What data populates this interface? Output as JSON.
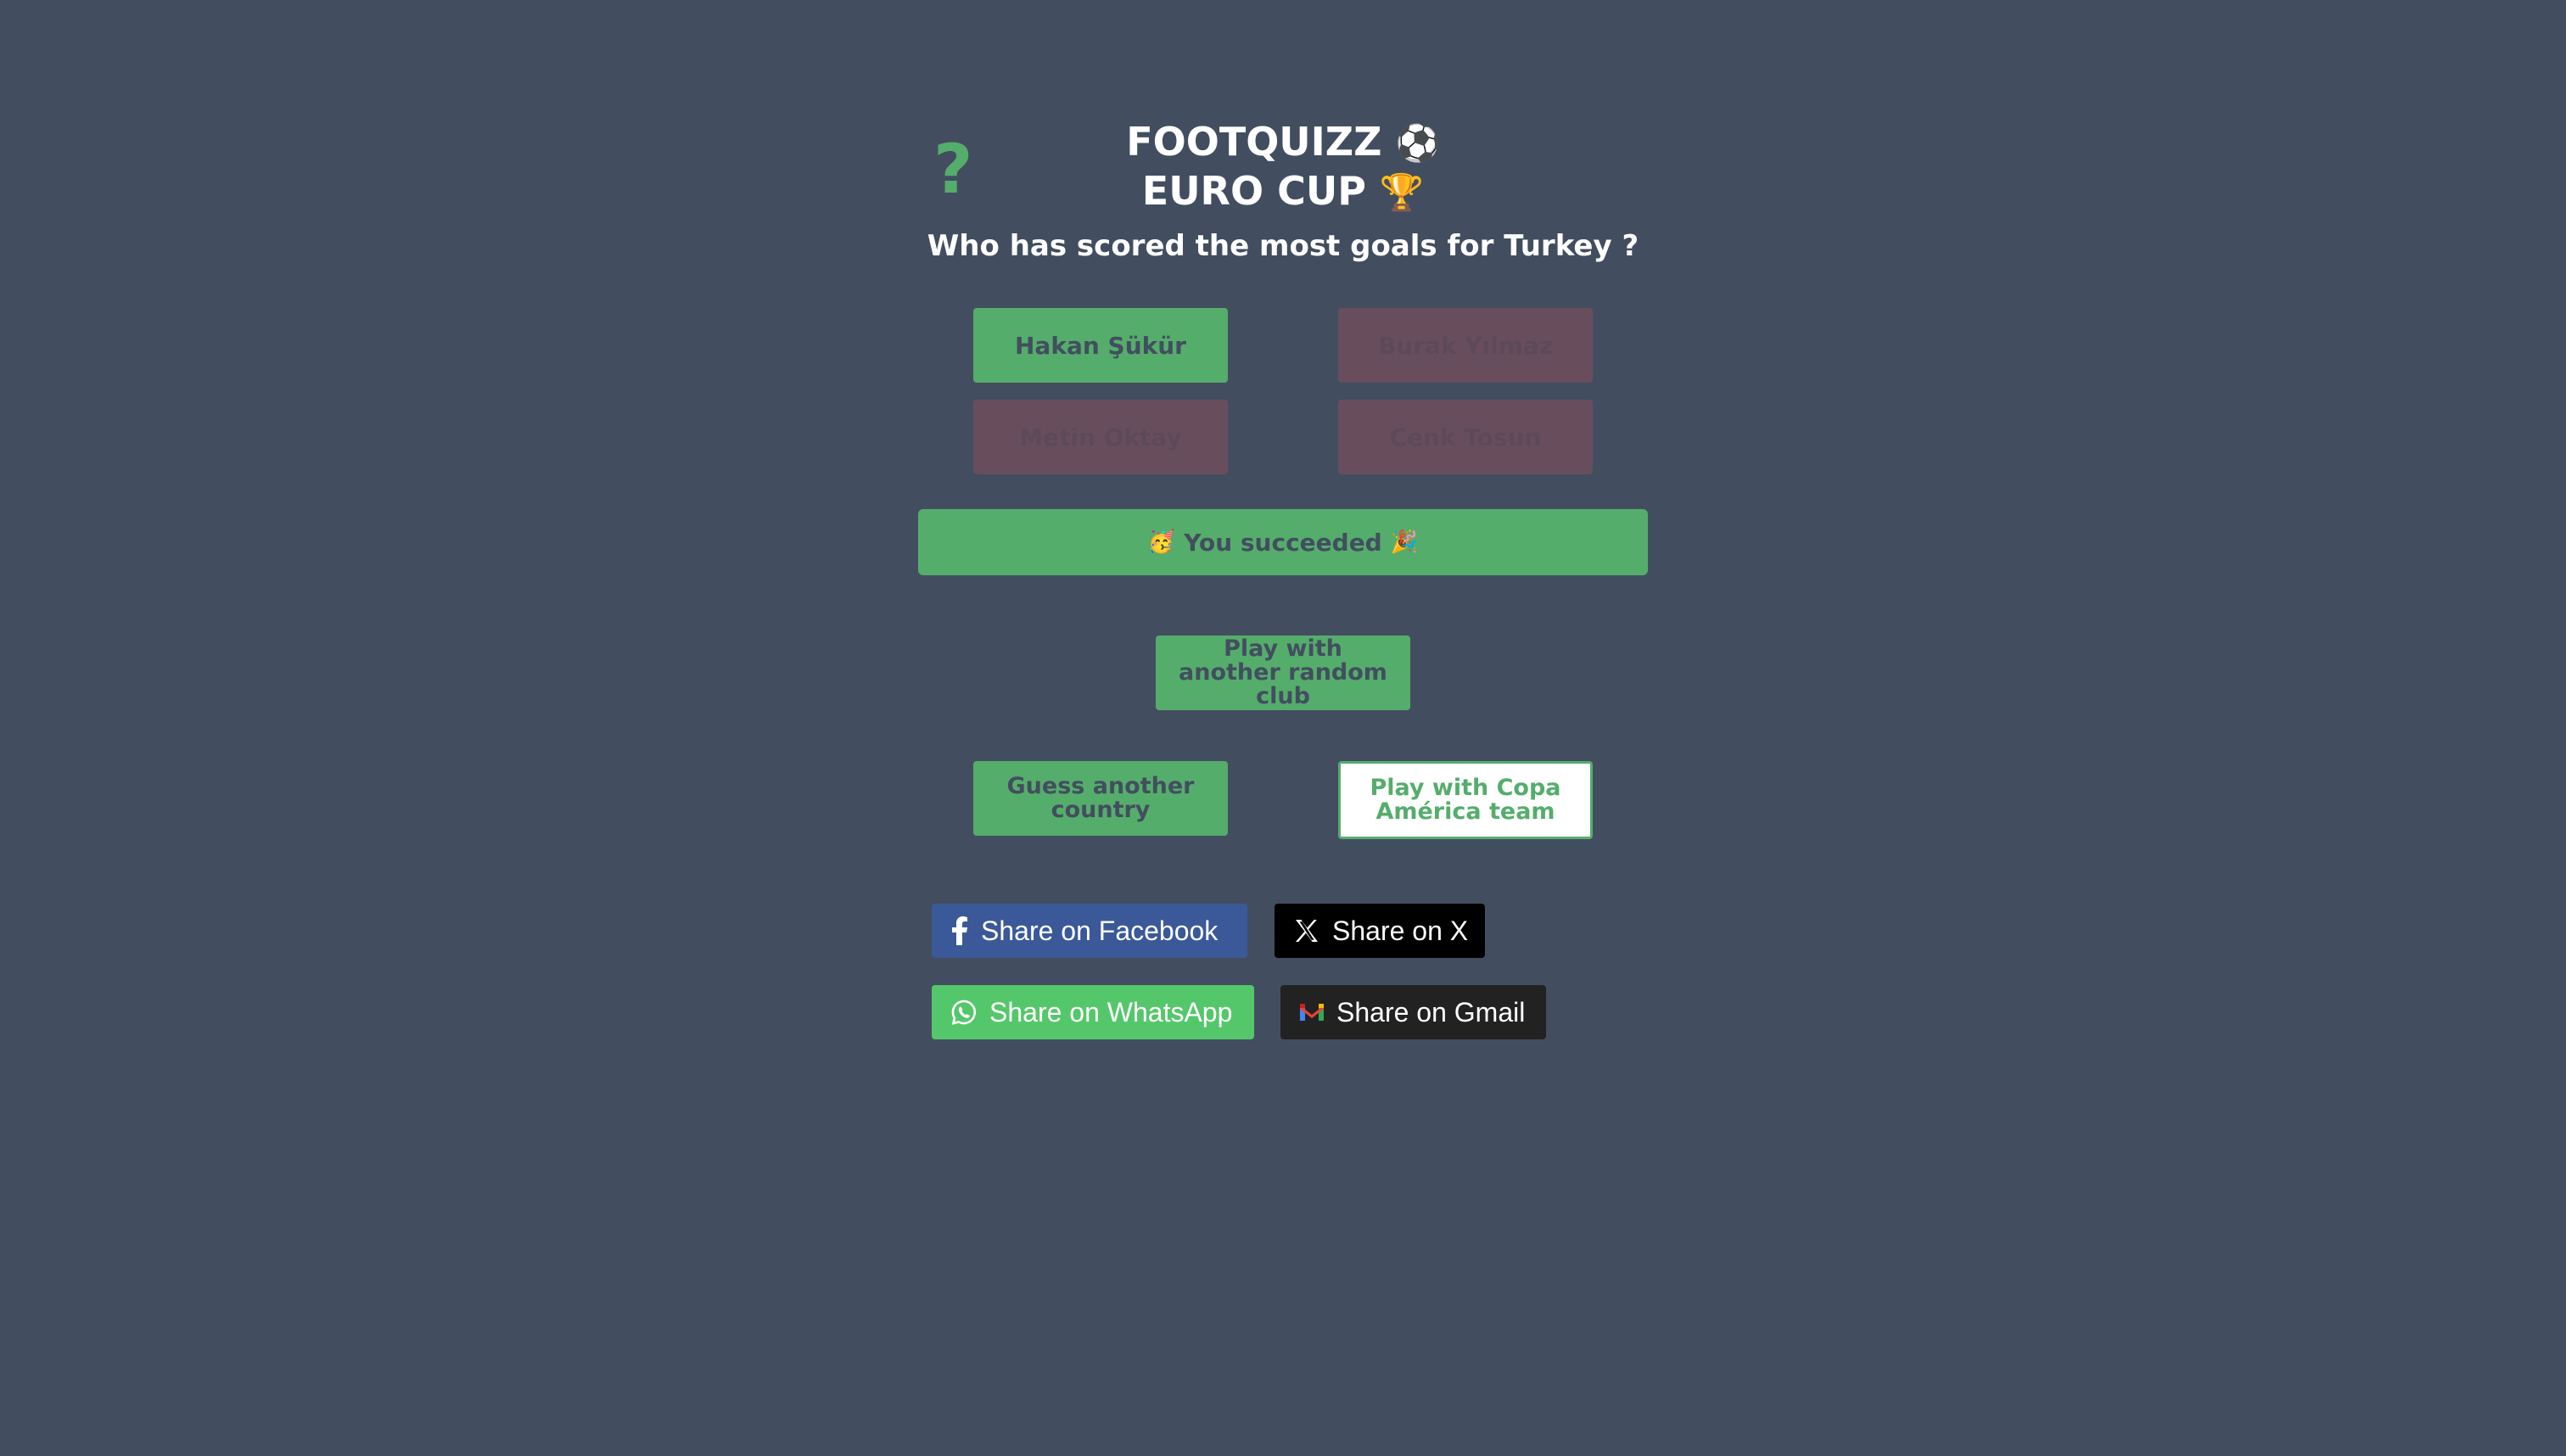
{
  "header": {
    "help_icon": "?",
    "title_line1": "FOOTQUIZZ",
    "title_line1_glyph": "⚽",
    "title_line2": "EURO CUP",
    "title_line2_glyph": "🏆"
  },
  "question": "Who has scored the most goals for Turkey ?",
  "answers": [
    {
      "label": "Hakan Şükür",
      "state": "correct"
    },
    {
      "label": "Burak Yılmaz",
      "state": "wrong"
    },
    {
      "label": "Metin Oktay",
      "state": "wrong"
    },
    {
      "label": "Cenk Tosun",
      "state": "wrong"
    }
  ],
  "result": {
    "label": "You succeeded",
    "glyph_left": "🥳",
    "glyph_right": "🎉"
  },
  "actions": {
    "random_club": "Play with another random club",
    "another_country": "Guess another country",
    "copa_america": "Play with Copa América team"
  },
  "share": {
    "facebook": "Share on Facebook",
    "x": "Share on X",
    "whatsapp": "Share on WhatsApp",
    "gmail": "Share on Gmail"
  },
  "icons": {
    "help": "question-mark-icon",
    "facebook": "facebook-icon",
    "x": "x-logo-icon",
    "whatsapp": "whatsapp-icon",
    "gmail": "gmail-icon"
  },
  "colors": {
    "background": "#424e5f",
    "accent_green": "#55ad6b",
    "wrong_answer": "#684e5d",
    "facebook": "#3b5998",
    "x": "#000000",
    "whatsapp": "#55c76b",
    "gmail": "#222222"
  }
}
